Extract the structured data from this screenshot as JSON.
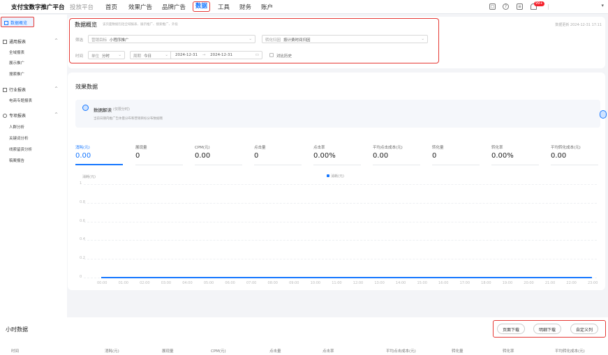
{
  "header": {
    "brand": "支付宝数字推广平台",
    "brand_sub": "投放平台",
    "nav": [
      "首页",
      "效果广告",
      "品牌广告",
      "数据",
      "工具",
      "财务",
      "账户"
    ],
    "badge": "99+",
    "colors": {
      "accent": "#1677ff",
      "highlight": "#e53935"
    }
  },
  "sidebar": {
    "active": "数据概览",
    "groups": [
      {
        "label": "通用报表",
        "items": [
          "全域报表",
          "展示推广",
          "搜索推广"
        ]
      },
      {
        "label": "行业报表",
        "items": [
          "电商专题报表"
        ]
      },
      {
        "label": "专项报表",
        "items": [
          "人群分析",
          "关键词分析",
          "线索留资分析",
          "稿案报告"
        ]
      }
    ]
  },
  "overview": {
    "title": "数据概览",
    "desc": "该页面数据包括全域报表、展示推广、搜索推广、外投",
    "update": "数据更新 2024-12-31 17:11",
    "filter_label": "筛选",
    "target_label": "营销目标",
    "target_value": "小程序推广",
    "conv_label": "转化归因",
    "conv_value": "按计费时间归因",
    "time_label": "时间",
    "unit_label": "单位",
    "unit_value": "分时",
    "period_label": "周期",
    "period_value": "今日",
    "date_start": "2024-12-31",
    "date_sep": "→",
    "date_end": "2024-12-31",
    "compare": "对比历史"
  },
  "effect": {
    "title": "效果数据",
    "insight_title": "数据解读",
    "insight_tag": "(仅限分时)",
    "insight_text": "当前日期内推广告体量分布和营销目标分布数据哦",
    "metrics": [
      {
        "label": "消耗(元)",
        "value": "0.00"
      },
      {
        "label": "展现量",
        "value": "0"
      },
      {
        "label": "CPM(元)",
        "value": "0.00"
      },
      {
        "label": "点击量",
        "value": "0"
      },
      {
        "label": "点击率",
        "value": "0.00%"
      },
      {
        "label": "平均点击成本(元)",
        "value": "0.00"
      },
      {
        "label": "转化量",
        "value": "0"
      },
      {
        "label": "转化率",
        "value": "0.00%"
      },
      {
        "label": "平均转化成本(元)",
        "value": "0.00"
      }
    ]
  },
  "chart_data": {
    "type": "line",
    "ylabel": "消耗(元)",
    "legend": "消耗(元)",
    "legend_position": "top-center",
    "ylim": [
      0,
      1
    ],
    "yticks": [
      "1",
      "0.8",
      "0.6",
      "0.4",
      "0.2",
      "0"
    ],
    "x": [
      "00:00",
      "01:00",
      "02:00",
      "03:00",
      "04:00",
      "05:00",
      "06:00",
      "07:00",
      "08:00",
      "09:00",
      "10:00",
      "11:00",
      "12:00",
      "13:00",
      "14:00",
      "15:00",
      "16:00",
      "17:00",
      "18:00",
      "19:00",
      "20:00",
      "21:00",
      "22:00",
      "23:00"
    ],
    "series": [
      {
        "name": "消耗(元)",
        "values": [
          0,
          0,
          0,
          0,
          0,
          0,
          0,
          0,
          0,
          0,
          0,
          0,
          0,
          0,
          0,
          0,
          0,
          0,
          0,
          0,
          0,
          0,
          0,
          0
        ]
      }
    ],
    "grid": true
  },
  "hourly": {
    "title": "小时数据",
    "buttons": [
      "页面下载",
      "明细下载",
      "自定义列"
    ],
    "columns": [
      "时间",
      "消耗(元)",
      "展现量",
      "CPM(元)",
      "点击量",
      "点击率",
      "平均点击成本(元)",
      "转化量",
      "转化率",
      "平均转化成本(元)"
    ]
  }
}
